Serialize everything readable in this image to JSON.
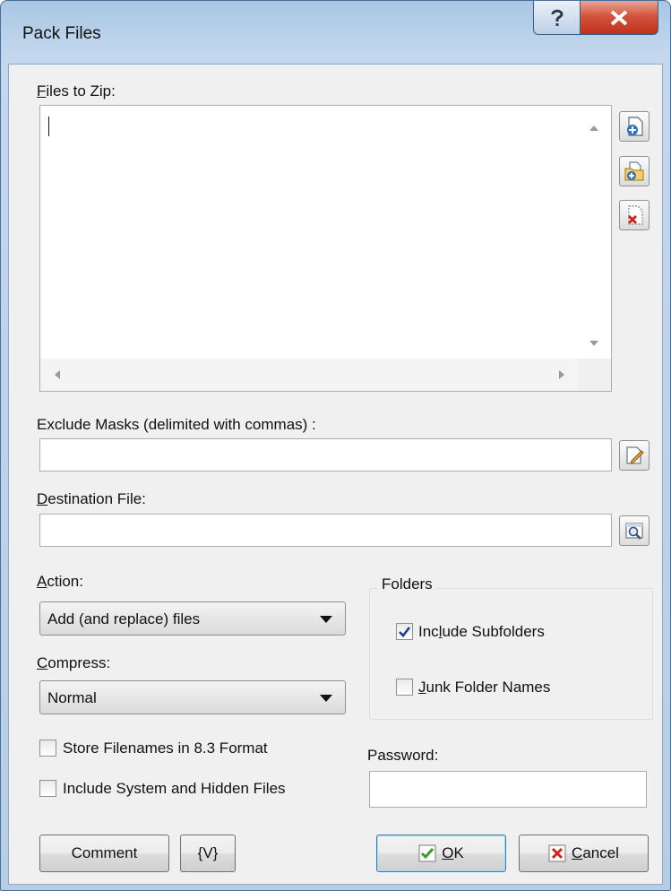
{
  "window": {
    "title": "Pack Files"
  },
  "files": {
    "label_prefix": "",
    "label_u": "F",
    "label_rest": "iles to Zip:",
    "value": ""
  },
  "exclude": {
    "label": "Exclude Masks (delimited with commas) :",
    "value": ""
  },
  "destination": {
    "label_u": "D",
    "label_rest": "estination File:",
    "value": ""
  },
  "action": {
    "label_u": "A",
    "label_rest": "ction:",
    "selected": "Add (and replace) files"
  },
  "compress": {
    "label_u": "C",
    "label_rest": "ompress:",
    "selected": "Normal"
  },
  "folders": {
    "title": "Folders",
    "include_subfolders": {
      "label_pre": "Inc",
      "label_u": "l",
      "label_rest": "ude Subfolders",
      "checked": true
    },
    "junk_names": {
      "label_pre": "",
      "label_u": "J",
      "label_rest": "unk Folder Names",
      "checked": false
    }
  },
  "options": {
    "store_83": {
      "label": "Store Filenames in 8.3 Format",
      "checked": false
    },
    "include_system": {
      "label": "Include System and Hidden Files",
      "checked": false
    }
  },
  "password": {
    "label": "Password:",
    "value": ""
  },
  "buttons": {
    "comment": "Comment",
    "variables": "{V}",
    "ok_u": "O",
    "ok_rest": "K",
    "cancel_u": "C",
    "cancel_rest": "ancel"
  },
  "colors": {
    "check_mark": "#1b3f91",
    "ok_icon": "#3a9a2e",
    "cancel_icon": "#d4231b"
  }
}
